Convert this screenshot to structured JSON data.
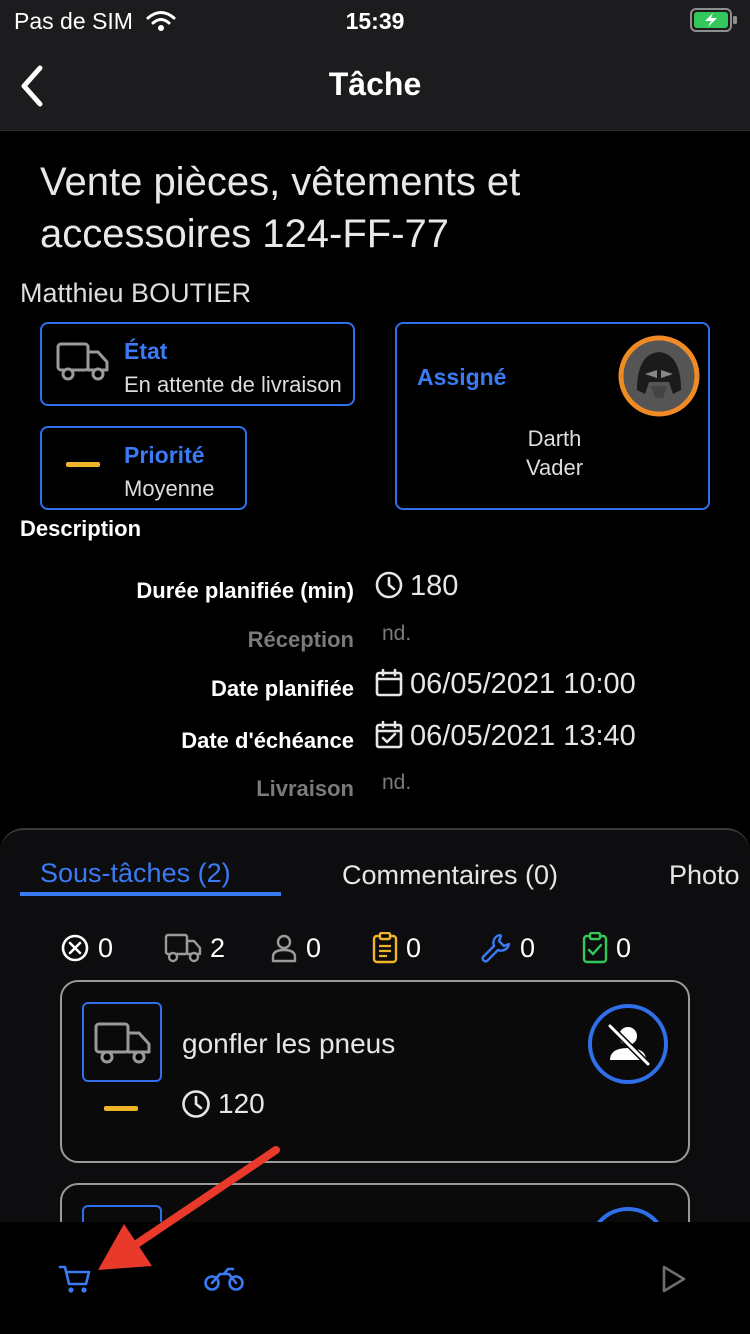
{
  "status_bar": {
    "carrier": "Pas de SIM",
    "time": "15:39"
  },
  "nav": {
    "title": "Tâche"
  },
  "task": {
    "title": "Vente pièces, vêtements et accessoires 124-FF-77",
    "customer": "Matthieu BOUTIER",
    "state": {
      "label": "État",
      "value": "En attente de livraison"
    },
    "priority": {
      "label": "Priorité",
      "value": "Moyenne"
    },
    "assigned": {
      "label": "Assigné",
      "name_line1": "Darth",
      "name_line2": "Vader"
    }
  },
  "description": {
    "title": "Description",
    "rows": [
      {
        "label": "Durée planifiée (min)",
        "value": "180"
      },
      {
        "label": "Réception",
        "value": "nd."
      },
      {
        "label": "Date planifiée",
        "value": "06/05/2021 10:00"
      },
      {
        "label": "Date d'échéance",
        "value": "06/05/2021 13:40"
      },
      {
        "label": "Livraison",
        "value": "nd."
      }
    ]
  },
  "tabs": [
    {
      "label": "Sous-tâches (2)",
      "active": true
    },
    {
      "label": "Commentaires (0)",
      "active": false
    },
    {
      "label": "Photo",
      "active": false
    }
  ],
  "counters": [
    {
      "icon": "x-circle-icon",
      "count": "0",
      "color": "#ffffff"
    },
    {
      "icon": "truck-icon",
      "count": "2",
      "color": "#9a9a9a"
    },
    {
      "icon": "person-icon",
      "count": "0",
      "color": "#9a9a9a"
    },
    {
      "icon": "clipboard-icon",
      "count": "0",
      "color": "#f0b429"
    },
    {
      "icon": "wrench-icon",
      "count": "0",
      "color": "#3a7bf3"
    },
    {
      "icon": "clipboard-check-icon",
      "count": "0",
      "color": "#34c759"
    }
  ],
  "subtasks": [
    {
      "title": "gonfler les pneus",
      "duration": "120",
      "priority_color": "#f0b429"
    }
  ],
  "colors": {
    "accent": "#3a7bf3",
    "priority_medium": "#f0b429",
    "battery": "#34c759",
    "avatar_ring": "#f08a24"
  }
}
